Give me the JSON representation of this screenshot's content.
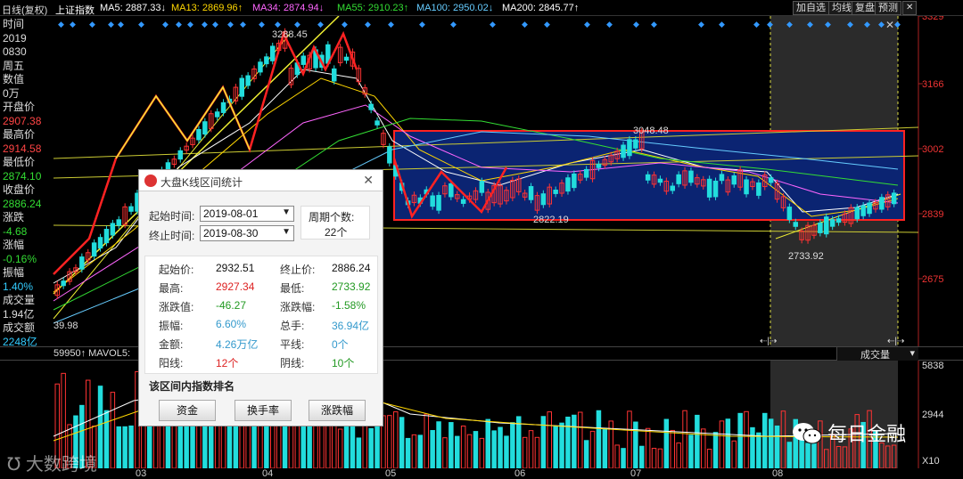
{
  "topbar": {
    "mode": "日线(复权)",
    "index_name": "上证指数",
    "ma": [
      {
        "label": "MA5: 2887.33↓",
        "color": "#ffffff"
      },
      {
        "label": "MA13: 2869.96↑",
        "color": "#ffd700"
      },
      {
        "label": "MA34: 2874.94↓",
        "color": "#ff66ff"
      },
      {
        "label": "MA55: 2910.23↑",
        "color": "#33dd33"
      },
      {
        "label": "MA100: 2950.02↓",
        "color": "#66ccff"
      },
      {
        "label": "MA200: 2845.77↑",
        "color": "#ffffff"
      }
    ],
    "buttons": [
      "加自选",
      "均线",
      "复盘",
      "预测"
    ]
  },
  "left_panel": [
    {
      "text": "时间",
      "color": "#dddddd"
    },
    {
      "text": "2019",
      "color": "#dddddd"
    },
    {
      "text": "0830",
      "color": "#dddddd"
    },
    {
      "text": "周五",
      "color": "#dddddd"
    },
    {
      "text": "数值",
      "color": "#dddddd"
    },
    {
      "text": "0万",
      "color": "#dddddd"
    },
    {
      "text": "开盘价",
      "color": "#dddddd"
    },
    {
      "text": "2907.38",
      "color": "#ff4444"
    },
    {
      "text": "最高价",
      "color": "#dddddd"
    },
    {
      "text": "2914.58",
      "color": "#ff4444"
    },
    {
      "text": "最低价",
      "color": "#dddddd"
    },
    {
      "text": "2874.10",
      "color": "#33dd33"
    },
    {
      "text": "收盘价",
      "color": "#dddddd"
    },
    {
      "text": "2886.24",
      "color": "#33dd33"
    },
    {
      "text": "涨跌",
      "color": "#dddddd"
    },
    {
      "text": "-4.68",
      "color": "#33dd33"
    },
    {
      "text": "涨幅",
      "color": "#dddddd"
    },
    {
      "text": "-0.16%",
      "color": "#33dd33"
    },
    {
      "text": "振幅",
      "color": "#dddddd"
    },
    {
      "text": "1.40%",
      "color": "#33ccff"
    },
    {
      "text": "成交量",
      "color": "#dddddd"
    },
    {
      "text": "1.94亿",
      "color": "#dddddd"
    },
    {
      "text": "成交额",
      "color": "#dddddd"
    },
    {
      "text": "2248亿",
      "color": "#33ccff"
    }
  ],
  "price_axis": [
    "3329",
    "3166",
    "3002",
    "2839",
    "2675"
  ],
  "volume_axis": [
    "5838",
    "2944",
    "X10"
  ],
  "annotations": {
    "high": "3288.45",
    "mid_high": "3048.48",
    "mid_low": "2822.19",
    "low": "2733.92",
    "left_cut": "39.98"
  },
  "volume_label": "59950↑ MAVOL5: ",
  "volume_dropdown": "成交量",
  "months": [
    "03",
    "04",
    "05",
    "06",
    "07",
    "08"
  ],
  "dialog": {
    "title": "大盘K线区间统计",
    "start_label": "起始时间:",
    "start_value": "2019-08-01",
    "end_label": "终止时间:",
    "end_value": "2019-08-30",
    "period_label": "周期个数:",
    "period_value": "22个",
    "stats": [
      {
        "k1": "起始价:",
        "v1": "2932.51",
        "c1": "#111111",
        "k2": "终止价:",
        "v2": "2886.24",
        "c2": "#111111"
      },
      {
        "k1": "最高:",
        "v1": "2927.34",
        "c1": "#dd2222",
        "k2": "最低:",
        "v2": "2733.92",
        "c2": "#229922"
      },
      {
        "k1": "涨跌值:",
        "v1": "-46.27",
        "c1": "#229922",
        "k2": "涨跌幅:",
        "v2": "-1.58%",
        "c2": "#229922"
      },
      {
        "k1": "振幅:",
        "v1": "6.60%",
        "c1": "#3399cc",
        "k2": "总手:",
        "v2": "36.94亿",
        "c2": "#3399cc"
      },
      {
        "k1": "金额:",
        "v1": "4.26万亿",
        "c1": "#3399cc",
        "k2": "平线:",
        "v2": "0个",
        "c2": "#3399cc"
      },
      {
        "k1": "阳线:",
        "v1": "12个",
        "c1": "#dd2222",
        "k2": "阴线:",
        "v2": "10个",
        "c2": "#229922"
      }
    ],
    "ranking_title": "该区间内指数排名",
    "buttons": [
      "资金",
      "换手率",
      "涨跌幅"
    ]
  },
  "wechat_label": "每日金融",
  "watermark": "大数跨境"
}
